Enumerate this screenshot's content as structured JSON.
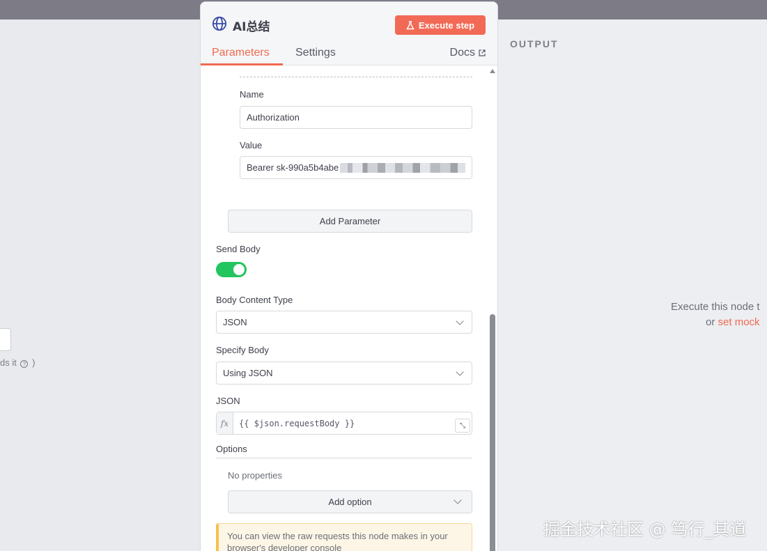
{
  "node": {
    "title": "AI总结",
    "execute_label": "Execute step",
    "tabs": [
      {
        "label": "Parameters",
        "active": true
      },
      {
        "label": "Settings",
        "active": false
      }
    ],
    "docs_label": "Docs"
  },
  "header_param": {
    "name_label": "Name",
    "name_value": "Authorization",
    "value_label": "Value",
    "value_value": "Bearer sk-990a5b4abe"
  },
  "add_parameter_label": "Add Parameter",
  "send_body": {
    "label": "Send Body",
    "enabled": true
  },
  "body_content_type": {
    "label": "Body Content Type",
    "value": "JSON"
  },
  "specify_body": {
    "label": "Specify Body",
    "value": "Using JSON"
  },
  "json_field": {
    "label": "JSON",
    "fx": "fx",
    "value": "{{ $json.requestBody }}"
  },
  "options": {
    "label": "Options",
    "empty_text": "No properties",
    "add_label": "Add option"
  },
  "notice": "You can view the raw requests this node makes in your browser's developer console",
  "output": {
    "title": "OUTPUT",
    "message": "Execute this node t",
    "or_text": "or ",
    "mock_link": "set mock"
  },
  "left_hint": "ds it",
  "watermark": "掘金技术社区 @ 笃行_其道",
  "colors": {
    "accent": "#f06a4f",
    "execute_button": "#f26a56",
    "toggle_on": "#22c55e",
    "notice_border": "#f5c14e"
  }
}
